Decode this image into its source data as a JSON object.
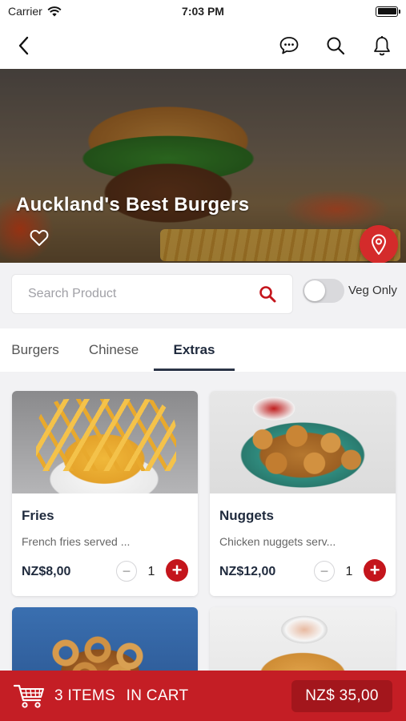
{
  "status_bar": {
    "carrier": "Carrier",
    "time": "7:03 PM"
  },
  "nav": {
    "back_icon": "chevron-left-icon",
    "chat_icon": "chat-bubble-icon",
    "search_icon": "search-icon",
    "bell_icon": "bell-icon"
  },
  "restaurant": {
    "name": "Auckland's Best Burgers",
    "favorite_icon": "heart-outline-icon",
    "location_icon": "map-pin-icon",
    "call_icon": "phone-icon",
    "colors": {
      "location": "#d42b2b",
      "call": "#3ecf57"
    }
  },
  "search": {
    "placeholder": "Search Product",
    "value": ""
  },
  "veg_toggle": {
    "label": "Veg Only",
    "on": false
  },
  "tabs": [
    {
      "label": "Burgers",
      "active": false
    },
    {
      "label": "Chinese",
      "active": false
    },
    {
      "label": "Extras",
      "active": true
    }
  ],
  "products": [
    {
      "name": "Fries",
      "description": "French fries served ...",
      "price": "NZ$8,00",
      "quantity": "1"
    },
    {
      "name": "Nuggets",
      "description": "Chicken nuggets serv...",
      "price": "NZ$12,00",
      "quantity": "1"
    },
    {
      "name": "",
      "description": "",
      "price": "",
      "quantity": ""
    },
    {
      "name": "",
      "description": "",
      "price": "",
      "quantity": ""
    }
  ],
  "stepper": {
    "minus": "−",
    "plus": "+"
  },
  "cart": {
    "count": "3",
    "items_label": "ITEMS",
    "in_cart_label": "IN CART",
    "total": "NZ$ 35,00",
    "colors": {
      "bar": "#c41e25",
      "total_bg": "#a3161c"
    }
  },
  "colors": {
    "accent": "#c4151c",
    "heading": "#1f2a3d"
  }
}
